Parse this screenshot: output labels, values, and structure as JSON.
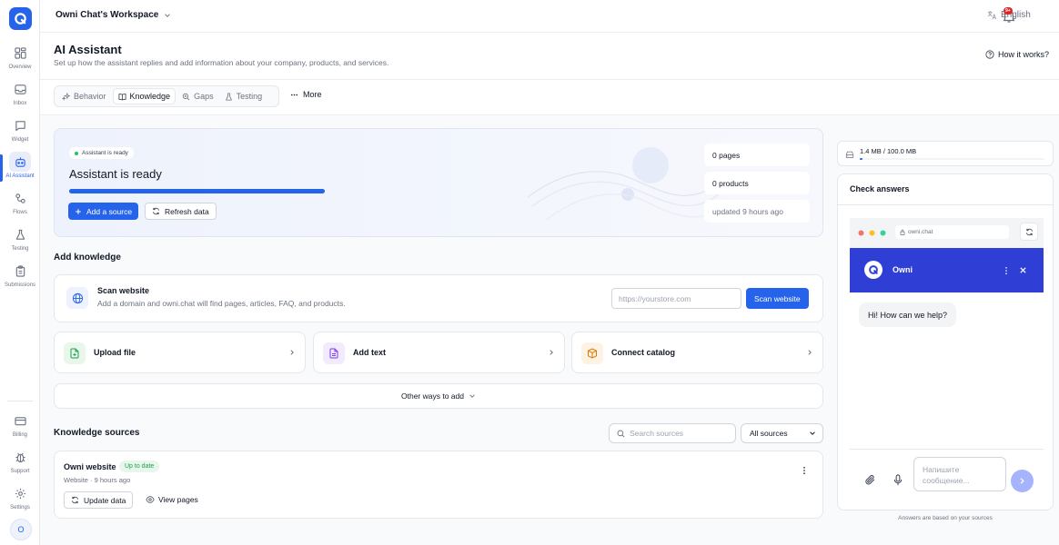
{
  "sidebar": {
    "items": [
      {
        "label": "Overview",
        "icon": "grid-icon"
      },
      {
        "label": "Inbox",
        "icon": "inbox-icon"
      },
      {
        "label": "Widget",
        "icon": "chat-bubble-icon"
      },
      {
        "label": "AI Assistant",
        "icon": "robot-icon",
        "active": true
      },
      {
        "label": "Flows",
        "icon": "flows-icon"
      },
      {
        "label": "Testing",
        "icon": "flask-icon"
      },
      {
        "label": "Submissions",
        "icon": "clipboard-icon"
      }
    ],
    "bottom_items": [
      {
        "label": "Billing",
        "icon": "card-icon"
      },
      {
        "label": "Support",
        "icon": "bug-icon"
      },
      {
        "label": "Settings",
        "icon": "gear-icon"
      }
    ],
    "avatar_initial": "O"
  },
  "topbar": {
    "workspace": "Owni Chat's Workspace",
    "language": "English",
    "notifications_badge": "9+"
  },
  "header": {
    "title": "AI Assistant",
    "subtitle": "Set up how the assistant replies and add information about your company, products, and services.",
    "how_it_works": "How it works?"
  },
  "tabs": [
    {
      "label": "Behavior",
      "icon": "sparkle-icon"
    },
    {
      "label": "Knowledge",
      "icon": "book-icon",
      "active": true
    },
    {
      "label": "Gaps",
      "icon": "search-plus-icon"
    },
    {
      "label": "Testing",
      "icon": "flask-icon"
    }
  ],
  "more_label": "More",
  "status": {
    "pill": "Assistant is ready",
    "title": "Assistant is ready",
    "progress_fraction": 1.0,
    "add_source": "Add a source",
    "refresh": "Refresh data",
    "stats": [
      "0 pages",
      "0 products",
      "updated 9 hours ago"
    ]
  },
  "add_knowledge": {
    "title": "Add knowledge",
    "scan": {
      "title": "Scan website",
      "desc": "Add a domain and owni.chat will find pages, articles, FAQ, and products.",
      "placeholder": "https://yourstore.com",
      "button": "Scan website"
    },
    "options": [
      {
        "label": "Upload file",
        "icon": "file-plus-icon",
        "color": "#16a34a",
        "bg": "#e8f6ec"
      },
      {
        "label": "Add text",
        "icon": "document-icon",
        "color": "#7c3aed",
        "bg": "#f1ebfd"
      },
      {
        "label": "Connect catalog",
        "icon": "box-icon",
        "color": "#d97706",
        "bg": "#fdf3e3"
      }
    ],
    "other_ways": "Other ways to add"
  },
  "sources": {
    "title": "Knowledge sources",
    "search_placeholder": "Search sources",
    "filter": "All sources",
    "items": [
      {
        "name": "Owni website",
        "status": "Up to date",
        "meta": "Website · 9 hours ago",
        "update": "Update data",
        "view": "View pages"
      }
    ]
  },
  "right": {
    "storage": "1.4 MB / 100.0 MB",
    "storage_fraction": 0.014,
    "check_title": "Check answers",
    "browser_url": "owni.chat",
    "chat_name": "Owni",
    "greeting": "Hi! How can we help?",
    "message_placeholder": "Напишите сообщение...",
    "footnote": "Answers are based on your sources"
  },
  "colors": {
    "accent": "#2563eb",
    "chat_header": "#2f3fd6",
    "success": "#16a34a"
  }
}
